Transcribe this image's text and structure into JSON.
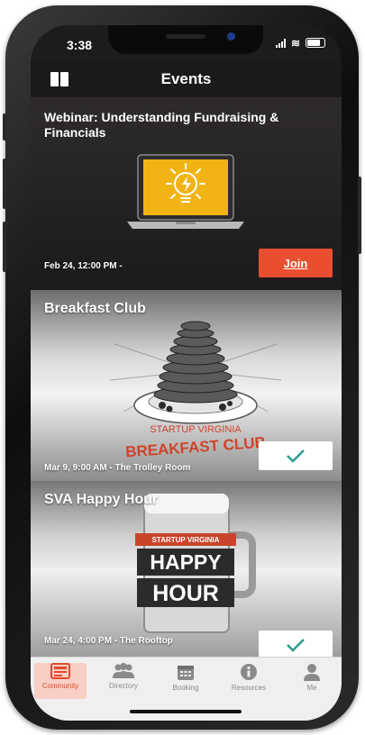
{
  "status": {
    "time": "3:38"
  },
  "header": {
    "title": "Events"
  },
  "events": [
    {
      "title": "Webinar: Understanding Fundraising & Financials",
      "date": "Feb 24, 12:00 PM -",
      "action_label": "Join"
    },
    {
      "title": "Breakfast Club",
      "date": "Mar 9, 9:00 AM - The Trolley Room",
      "poster_top": "STARTUP VIRGINIA",
      "poster_bottom": "BREAKFAST CLUB"
    },
    {
      "title": "SVA Happy Hour",
      "date": "Mar 24, 4:00 PM - The Rooftop",
      "poster_top": "STARTUP VIRGINIA",
      "poster_line1": "HAPPY",
      "poster_line2": "HOUR"
    }
  ],
  "tabs": [
    {
      "label": "Community",
      "icon": "community-icon",
      "active": true
    },
    {
      "label": "Directory",
      "icon": "people-icon"
    },
    {
      "label": "Booking",
      "icon": "calendar-icon"
    },
    {
      "label": "Resources",
      "icon": "info-icon"
    },
    {
      "label": "Me",
      "icon": "person-icon"
    }
  ],
  "colors": {
    "accent": "#e94e2f",
    "check": "#2a9d8f",
    "navbar": "#1a1a1a",
    "tabbar": "#efefef"
  }
}
